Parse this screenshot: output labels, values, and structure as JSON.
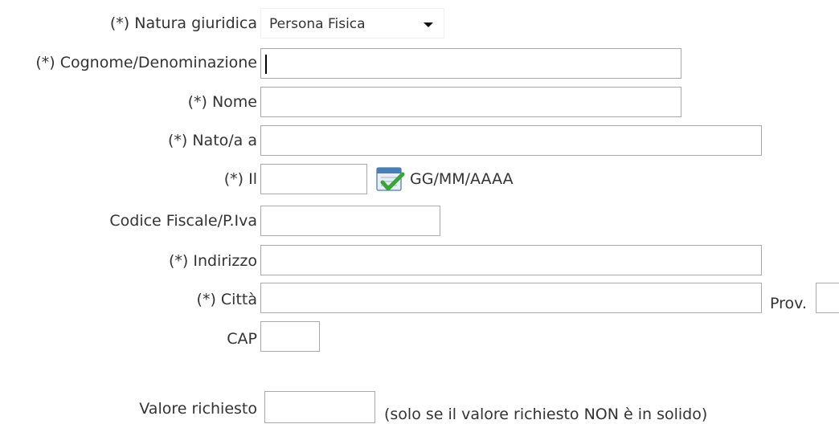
{
  "form": {
    "natura_label": "(*) Natura giuridica",
    "natura_value": "Persona Fisica",
    "cognome_label": "(*) Cognome/Denominazione",
    "nome_label": "(*) Nome",
    "nato_label": "(*) Nato/a a",
    "il_label": "(*) Il",
    "date_hint": "GG/MM/AAAA",
    "cf_label": "Codice Fiscale/P.Iva",
    "indirizzo_label": "(*) Indirizzo",
    "citta_label": "(*) Città",
    "prov_label": "Prov.",
    "cap_label": "CAP",
    "valore_label": "Valore richiesto",
    "valore_note": "(solo se il valore richiesto NON è in solido)"
  },
  "icons": {
    "calendar": "calendar-check-icon"
  },
  "colors": {
    "field_border": "#a9a9a9",
    "text": "#333333",
    "check_green": "#3aa53a",
    "calendar_blue": "#4a7fb5"
  }
}
